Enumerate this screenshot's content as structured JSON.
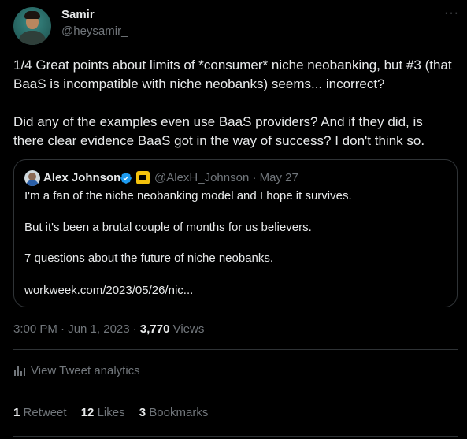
{
  "author": {
    "display_name": "Samir",
    "handle": "@heysamir_"
  },
  "tweet": {
    "paragraphs": [
      "1/4 Great points about limits of *consumer* niche neobanking, but #3 (that BaaS is incompatible with niche neobanks) seems... incorrect?",
      "Did any of the examples even use BaaS providers? And if they did, is there clear evidence BaaS got in the way of success? I don't think so."
    ]
  },
  "quoted_tweet": {
    "display_name": "Alex Johnson",
    "handle_date": "@AlexH_Johnson · May 27",
    "lines": [
      "I'm a fan of the niche neobanking model and I hope it survives.",
      "But it's been a brutal couple of months for us believers.",
      "7 questions about the future of niche neobanks.",
      "workweek.com/2023/05/26/nic..."
    ]
  },
  "meta": {
    "time_date": "3:00 PM · Jun 1, 2023 · ",
    "views_count": "3,770",
    "views_label": " Views"
  },
  "analytics_label": "View Tweet analytics",
  "stats": {
    "retweets_count": "1",
    "retweets_label": "Retweet",
    "likes_count": "12",
    "likes_label": "Likes",
    "bookmarks_count": "3",
    "bookmarks_label": "Bookmarks"
  },
  "icons": {
    "more": "more-horizontal-icon",
    "verified": "verified-badge-icon",
    "affiliate": "affiliate-badge-icon",
    "analytics": "bar-chart-icon"
  },
  "colors": {
    "background": "#000000",
    "text": "#e7e9ea",
    "secondary": "#71767b",
    "border": "#2f3336",
    "verified": "#1d9bf0",
    "affiliate": "#f4c20d"
  }
}
